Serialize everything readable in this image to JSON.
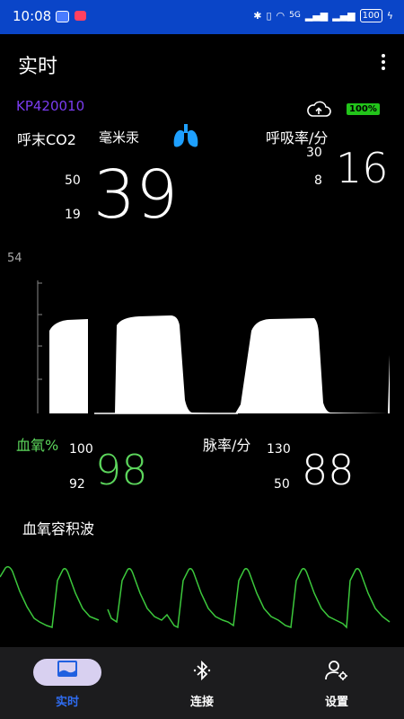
{
  "status_bar": {
    "time": "10:08",
    "signal_text": "5G",
    "battery": "100"
  },
  "app_bar": {
    "title": "实时"
  },
  "device": {
    "id": "KP420010",
    "battery_percent": "100%"
  },
  "etco2": {
    "label": "呼末CO2",
    "unit": "毫米汞",
    "value": "39",
    "upper": "50",
    "lower": "19",
    "scale_top": "54"
  },
  "resp_rate": {
    "label": "呼吸率/分",
    "value": "16",
    "upper": "30",
    "lower": "8"
  },
  "spo2": {
    "label": "血氧%",
    "value": "98",
    "upper": "100",
    "lower": "92"
  },
  "pulse_rate": {
    "label": "脉率/分",
    "value": "88",
    "upper": "130",
    "lower": "50"
  },
  "pleth": {
    "label": "血氧容积波"
  },
  "nav": [
    {
      "label": "实时",
      "icon": "realtime-icon",
      "selected": true
    },
    {
      "label": "连接",
      "icon": "bluetooth-icon",
      "selected": false
    },
    {
      "label": "设置",
      "icon": "user-settings-icon",
      "selected": false
    }
  ],
  "colors": {
    "status_bar": "#0a45c8",
    "device_id": "#7a3cf0",
    "spo2_green": "#5cd65c",
    "lung_blue": "#1ea0ff",
    "nav_pill": "#d8d0f0",
    "battery_badge": "#22c41a"
  }
}
